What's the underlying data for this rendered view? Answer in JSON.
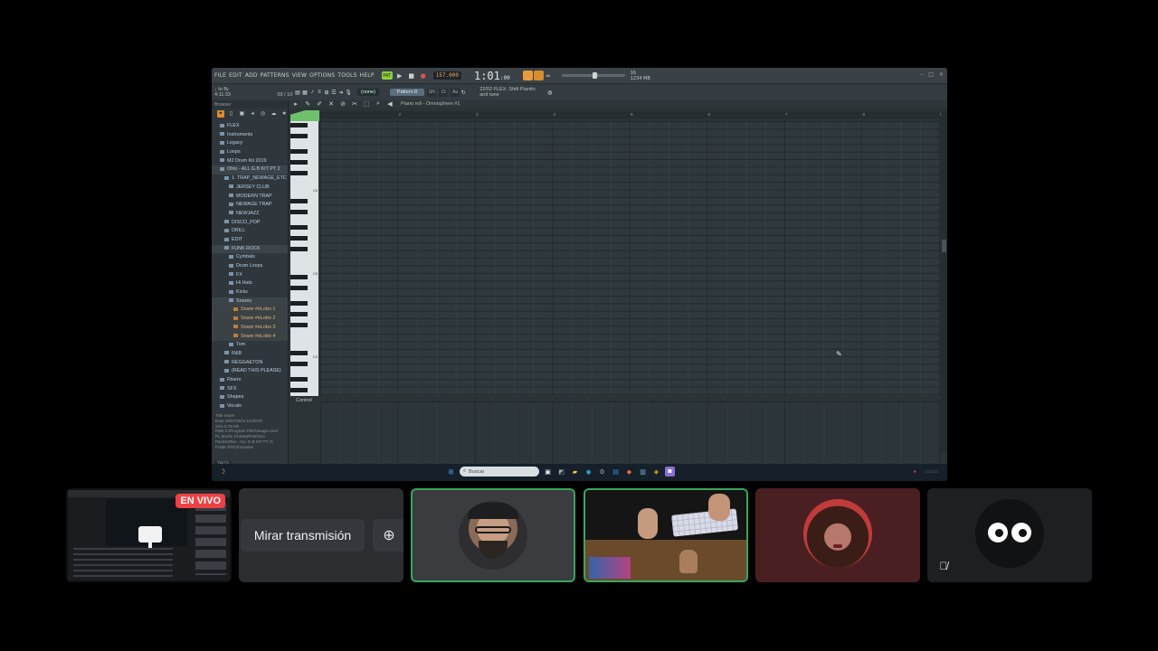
{
  "stream": {
    "menus": [
      "FILE",
      "EDIT",
      "ADD",
      "PATTERNS",
      "VIEW",
      "OPTIONS",
      "TOOLS",
      "HELP"
    ],
    "transport": {
      "pattern_label": "PAT",
      "tempo": "157.000",
      "time_main": "1:01",
      "time_sub": ":00"
    },
    "cpu": {
      "top": "16",
      "bottom": "1234 MB"
    },
    "hint_line1": "↓ to fly",
    "hint_line2": "4:11:33",
    "hint_counter": "03 / 10",
    "preset_dropdown": "(none)",
    "pattern_name": "Pattern 8",
    "plugin_line1": "22/02  FLEX: Shift Pianito",
    "plugin_line2": "and tune",
    "browser_title": "Browser",
    "browser_items": [
      {
        "label": "FLEX",
        "indent": 1,
        "type": "folder"
      },
      {
        "label": "Instruments",
        "indent": 1,
        "type": "folder"
      },
      {
        "label": "Legacy",
        "indent": 1,
        "type": "folder"
      },
      {
        "label": "Loops",
        "indent": 1,
        "type": "folder"
      },
      {
        "label": "M2 Drum Kit 2019",
        "indent": 1,
        "type": "folder"
      },
      {
        "label": "Ohio - ALL G.B KIT PT 2",
        "indent": 1,
        "type": "folder"
      },
      {
        "label": "1. TRAP_NEWAGE_ETC",
        "indent": 2,
        "type": "folder"
      },
      {
        "label": "JERSEY CLUB",
        "indent": 3,
        "type": "folder"
      },
      {
        "label": "MODERN TRAP",
        "indent": 3,
        "type": "folder"
      },
      {
        "label": "NEWAGE TRAP",
        "indent": 3,
        "type": "folder"
      },
      {
        "label": "NEWJAZZ",
        "indent": 3,
        "type": "folder"
      },
      {
        "label": "DISCO_POP",
        "indent": 2,
        "type": "folder"
      },
      {
        "label": "DRILL",
        "indent": 2,
        "type": "folder"
      },
      {
        "label": "EDIT",
        "indent": 2,
        "type": "folder"
      },
      {
        "label": "FUNK ROCK",
        "indent": 2,
        "type": "folder"
      },
      {
        "label": "Cymbals",
        "indent": 3,
        "type": "folder"
      },
      {
        "label": "Drum Loops",
        "indent": 3,
        "type": "folder"
      },
      {
        "label": "FX",
        "indent": 3,
        "type": "folder"
      },
      {
        "label": "Hi Hats",
        "indent": 3,
        "type": "folder"
      },
      {
        "label": "Kicks",
        "indent": 3,
        "type": "folder"
      },
      {
        "label": "Snares",
        "indent": 3,
        "type": "folder"
      },
      {
        "label": "Snare #eLobo 1",
        "indent": 4,
        "type": "file"
      },
      {
        "label": "Snare #eLobo 2",
        "indent": 4,
        "type": "file"
      },
      {
        "label": "Snare #eLobo 3",
        "indent": 4,
        "type": "file"
      },
      {
        "label": "Snare #eLobo 4",
        "indent": 4,
        "type": "file"
      },
      {
        "label": "Tom",
        "indent": 3,
        "type": "folder"
      },
      {
        "label": "R&B",
        "indent": 2,
        "type": "folder"
      },
      {
        "label": "REGGAETON",
        "indent": 2,
        "type": "folder"
      },
      {
        "label": "(READ THIS PLEASE)",
        "indent": 2,
        "type": "folder"
      },
      {
        "label": "Risers",
        "indent": 1,
        "type": "folder"
      },
      {
        "label": "SFX",
        "indent": 1,
        "type": "folder"
      },
      {
        "label": "Shapes",
        "indent": 1,
        "type": "folder"
      },
      {
        "label": "Vocals",
        "indent": 1,
        "type": "folder"
      }
    ],
    "browser_info": [
      "Title   Snare",
      "Date    20/07/2024 19:00:00",
      "Size    5.75 KB",
      "Path    C:\\Program Files\\Image-Line\\",
      "FL Studio 21\\Data\\Patches\\",
      "Packs\\Ohio - ALL G.B KIT PT 2\\",
      "FUNK ROCK\\Snares"
    ],
    "browser_tags": "TAGS",
    "piano_roll_title": "Piano roll - Omnisphere #1",
    "ruler_marks": [
      "2",
      "3",
      "4",
      "5",
      "6",
      "7",
      "8",
      "9"
    ],
    "key_labels": [
      "C6",
      "C5",
      "C4"
    ],
    "control_label": "Control",
    "taskbar": {
      "search_placeholder": "Buscar"
    }
  },
  "call": {
    "live_badge": "EN VIVO",
    "watch_button": "Mirar transmisión",
    "accent_speaking": "#3ba55c",
    "live_color": "#ed4245"
  }
}
